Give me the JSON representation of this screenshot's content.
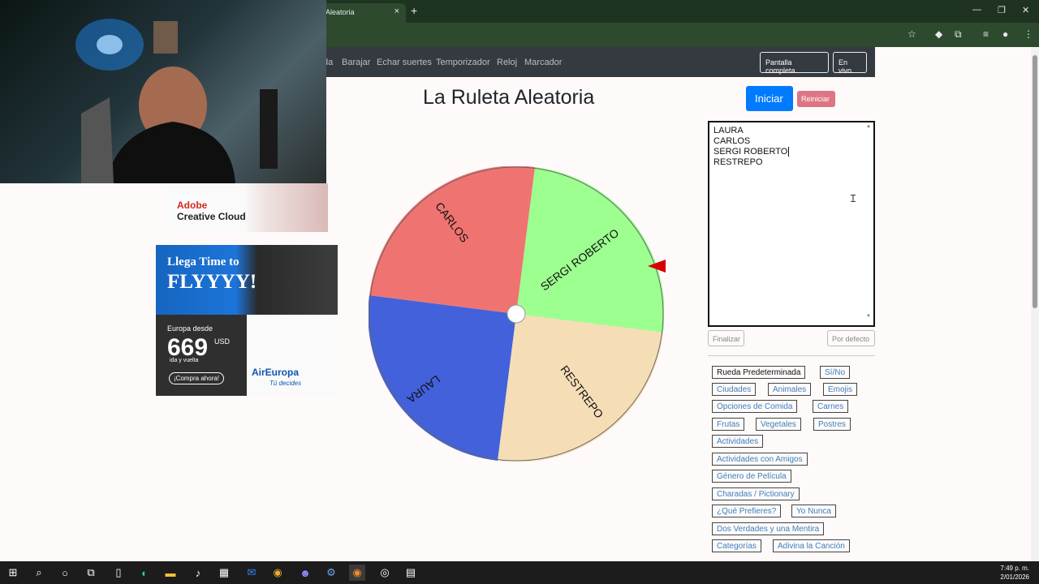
{
  "browser": {
    "tab_title": "Aleatoria",
    "tab_close": "×",
    "new_tab": "+",
    "minimize": "—",
    "restore": "❐",
    "close": "✕",
    "toolbar_icons": [
      "star-icon",
      "extension-diamond-icon",
      "puzzle-icon",
      "media-icon",
      "profile-icon",
      "menu-icon"
    ]
  },
  "site_nav": {
    "partial_link": "da",
    "links": [
      "Barajar",
      "Echar suertes",
      "Temporizador",
      "Reloj",
      "Marcador"
    ],
    "fullscreen": "Pantalla completa",
    "live": "En vivo"
  },
  "ads": {
    "adobe_brand": "Adobe",
    "adobe_product": "Creative Cloud",
    "air_line1": "Llega Time to",
    "air_line2": "FLYYYY!",
    "air_from": "Europa desde",
    "air_price": "669",
    "air_currency": "USD",
    "air_roundtrip": "ida y vuelta",
    "air_cta": "¡Compra ahora!",
    "air_brand": "AirEuropa",
    "air_tagline": "Tú decides"
  },
  "wheel": {
    "title": "La Ruleta Aleatoria",
    "start": "Iniciar",
    "reset": "Reiniciar",
    "segments": [
      {
        "label": "SERGI ROBERTO",
        "color": "#9cff8f"
      },
      {
        "label": "RESTREPO",
        "color": "#f5ddb6"
      },
      {
        "label": "LAURA",
        "color": "#4361db"
      },
      {
        "label": "CARLOS",
        "color": "#ef7471"
      }
    ],
    "pointer_color": "#d40000"
  },
  "names_editor": {
    "lines": [
      "LAURA",
      "CARLOS",
      "SERGI ROBERTO",
      "RESTREPO"
    ],
    "finalize": "Finalizar",
    "default": "Por defecto"
  },
  "presets": [
    "Rueda Predeterminada",
    "Sí/No",
    "Ciudades",
    "Animales",
    "Emojis",
    "Opciones de Comida",
    "Carnes",
    "Frutas",
    "Vegetales",
    "Postres",
    "Actividades",
    "Actividades con Amigos",
    "Género de Película",
    "Charadas / Pictionary",
    "¿Qué Prefieres?",
    "Yo Nunca",
    "Dos Verdades y una Mentira",
    "Categorías",
    "Adivina la Canción"
  ],
  "taskbar": {
    "icons": [
      "windows-icon",
      "search-icon",
      "cortana-icon",
      "task-view-icon",
      "file-icon",
      "edge-icon",
      "file-explorer-icon",
      "tiktok-icon",
      "store-icon",
      "mail-icon",
      "chrome-icon",
      "discord-icon",
      "steam-icon",
      "chrome-active-icon",
      "obs-icon",
      "calculator-icon"
    ],
    "time": "7:49 p. m.",
    "date": "2/01/2026"
  }
}
